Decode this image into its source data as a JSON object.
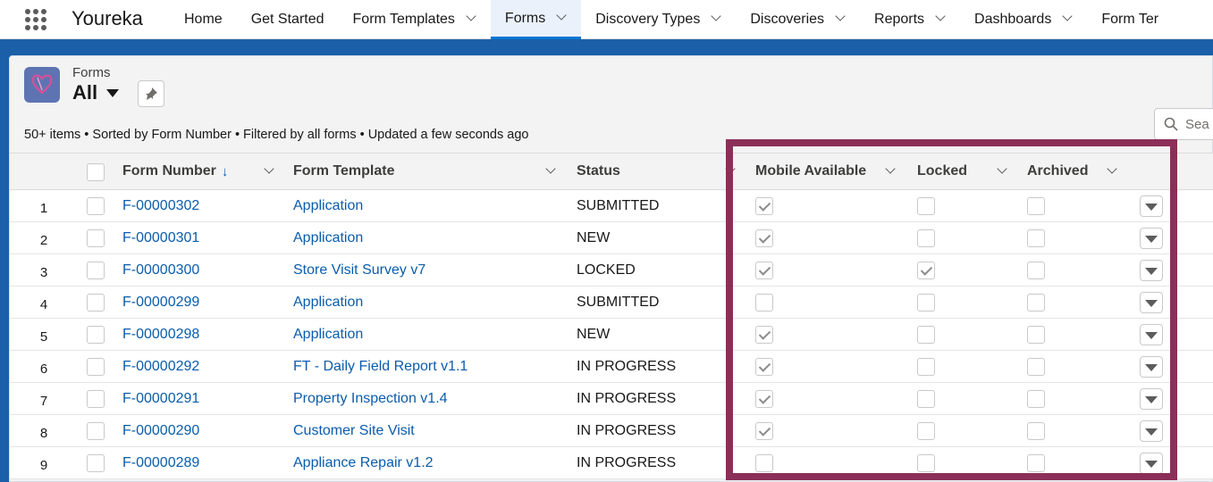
{
  "app": {
    "name": "Youreka"
  },
  "nav": {
    "items": [
      {
        "label": "Home",
        "dropdown": false,
        "active": false
      },
      {
        "label": "Get Started",
        "dropdown": false,
        "active": false
      },
      {
        "label": "Form Templates",
        "dropdown": true,
        "active": false
      },
      {
        "label": "Forms",
        "dropdown": true,
        "active": true
      },
      {
        "label": "Discovery Types",
        "dropdown": true,
        "active": false
      },
      {
        "label": "Discoveries",
        "dropdown": true,
        "active": false
      },
      {
        "label": "Reports",
        "dropdown": true,
        "active": false
      },
      {
        "label": "Dashboards",
        "dropdown": true,
        "active": false
      },
      {
        "label": "Form Ter",
        "dropdown": false,
        "active": false
      }
    ]
  },
  "list": {
    "object_type": "Forms",
    "name": "All",
    "meta": "50+ items • Sorted by Form Number • Filtered by all forms • Updated a few seconds ago",
    "search_placeholder": "Sea"
  },
  "table": {
    "columns": {
      "form_number": "Form Number",
      "form_template": "Form Template",
      "status": "Status",
      "mobile_available": "Mobile Available",
      "locked": "Locked",
      "archived": "Archived"
    },
    "sort_indicator": "↓",
    "rows": [
      {
        "num": "1",
        "form_number": "F-00000302",
        "template": "Application",
        "status": "SUBMITTED",
        "mobile": true,
        "locked": false,
        "archived": false
      },
      {
        "num": "2",
        "form_number": "F-00000301",
        "template": "Application",
        "status": "NEW",
        "mobile": true,
        "locked": false,
        "archived": false
      },
      {
        "num": "3",
        "form_number": "F-00000300",
        "template": "Store Visit Survey v7",
        "status": "LOCKED",
        "mobile": true,
        "locked": true,
        "archived": false
      },
      {
        "num": "4",
        "form_number": "F-00000299",
        "template": "Application",
        "status": "SUBMITTED",
        "mobile": false,
        "locked": false,
        "archived": false
      },
      {
        "num": "5",
        "form_number": "F-00000298",
        "template": "Application",
        "status": "NEW",
        "mobile": true,
        "locked": false,
        "archived": false
      },
      {
        "num": "6",
        "form_number": "F-00000292",
        "template": "FT - Daily Field Report v1.1",
        "status": "IN PROGRESS",
        "mobile": true,
        "locked": false,
        "archived": false
      },
      {
        "num": "7",
        "form_number": "F-00000291",
        "template": "Property Inspection v1.4",
        "status": "IN PROGRESS",
        "mobile": true,
        "locked": false,
        "archived": false
      },
      {
        "num": "8",
        "form_number": "F-00000290",
        "template": "Customer Site Visit",
        "status": "IN PROGRESS",
        "mobile": true,
        "locked": false,
        "archived": false
      },
      {
        "num": "9",
        "form_number": "F-00000289",
        "template": "Appliance Repair v1.2",
        "status": "IN PROGRESS",
        "mobile": false,
        "locked": false,
        "archived": false
      }
    ]
  },
  "colors": {
    "highlight": "#8b2f59",
    "link": "#0b5cab",
    "brand_band": "#1b5fa8"
  }
}
